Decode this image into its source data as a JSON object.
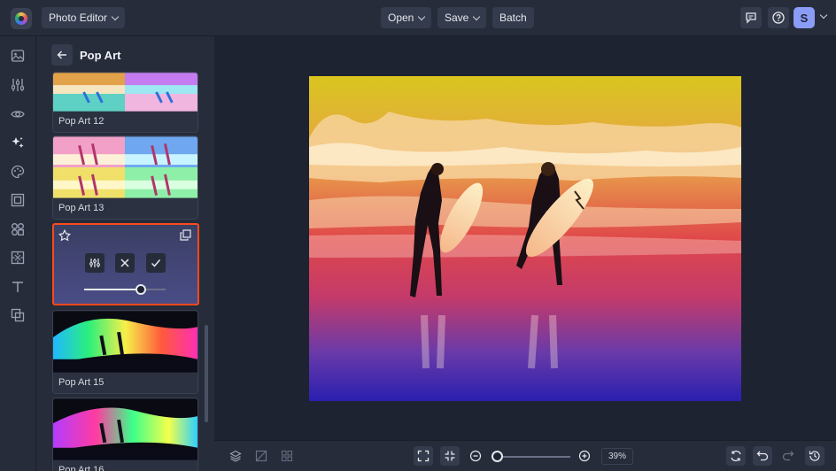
{
  "topbar": {
    "app_menu_label": "Photo Editor",
    "open_label": "Open",
    "save_label": "Save",
    "batch_label": "Batch",
    "avatar_initial": "S"
  },
  "leftrail": {
    "items": [
      "image-icon",
      "adjustments-icon",
      "eye-icon",
      "effects-icon",
      "palette-icon",
      "frame-icon",
      "shapes-icon",
      "texture-icon",
      "text-icon",
      "overlay-icon"
    ]
  },
  "panel": {
    "title": "Pop Art",
    "cards": [
      {
        "label": "Pop Art 12"
      },
      {
        "label": "Pop Art 13"
      },
      {
        "label": "Pop Art 15"
      },
      {
        "label": "Pop Art 16"
      }
    ],
    "active_card": {
      "intensity": 0.7
    }
  },
  "zoom": {
    "value": "39%",
    "level": 0.39
  },
  "colors": {
    "accent_selected": "#ff4a1c",
    "avatar_bg": "#8a9cf6"
  }
}
